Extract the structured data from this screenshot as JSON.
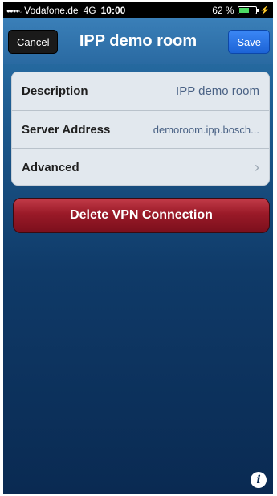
{
  "status_bar": {
    "signal": "●●●●○",
    "carrier": "Vodafone.de",
    "network": "4G",
    "time": "10:00",
    "battery_pct_label": "62 %",
    "battery_level": 0.62,
    "charging_icon": "bolt-icon"
  },
  "nav": {
    "cancel_label": "Cancel",
    "title": "IPP demo room",
    "save_label": "Save"
  },
  "form": {
    "rows": [
      {
        "label": "Description",
        "value": "IPP demo room"
      },
      {
        "label": "Server Address",
        "value": "demoroom.ipp.bosch..."
      },
      {
        "label": "Advanced",
        "value": ""
      }
    ]
  },
  "delete_label": "Delete VPN Connection",
  "icons": {
    "info": "info-icon",
    "chevron": "chevron-right-icon"
  },
  "colors": {
    "nav_blue": "#2a6aa2",
    "save_blue": "#1c63d6",
    "delete_red": "#9a1a28"
  }
}
